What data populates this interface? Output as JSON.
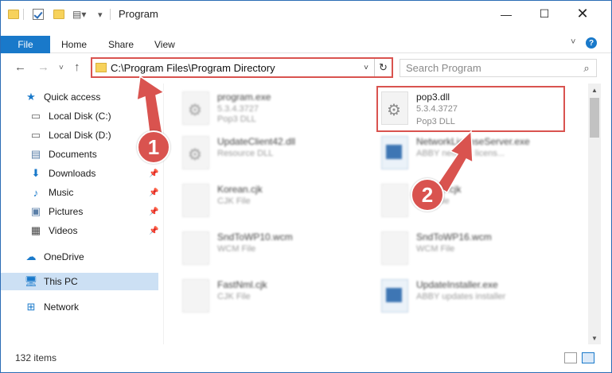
{
  "window": {
    "title": "Program"
  },
  "ribbon": {
    "file": "File",
    "home": "Home",
    "share": "Share",
    "view": "View"
  },
  "address": {
    "path": "C:\\Program Files\\Program Directory"
  },
  "search": {
    "placeholder": "Search Program"
  },
  "sidebar": {
    "items": [
      {
        "label": "Quick access",
        "icon": "star-icon"
      },
      {
        "label": "Local Disk (C:)",
        "icon": "drive-icon"
      },
      {
        "label": "Local Disk (D:)",
        "icon": "drive-icon"
      },
      {
        "label": "Documents",
        "icon": "documents-icon"
      },
      {
        "label": "Downloads",
        "icon": "download-icon"
      },
      {
        "label": "Music",
        "icon": "music-icon"
      },
      {
        "label": "Pictures",
        "icon": "pictures-icon"
      },
      {
        "label": "Videos",
        "icon": "videos-icon"
      },
      {
        "label": "OneDrive",
        "icon": "cloud-icon"
      },
      {
        "label": "This PC",
        "icon": "computer-icon"
      },
      {
        "label": "Network",
        "icon": "network-icon"
      }
    ]
  },
  "files": [
    {
      "name": "program.exe",
      "version": "5.3.4.3727",
      "type": "Pop3 DLL"
    },
    {
      "name": "pop3.dll",
      "version": "5.3.4.3727",
      "type": "Pop3 DLL"
    },
    {
      "name": "UpdateClient42.dll",
      "type": "Resource DLL"
    },
    {
      "name": "NetworkLicenseServer.exe",
      "type": "ABBY network licens..."
    },
    {
      "name": "Korean.cjk",
      "type": "CJK File"
    },
    {
      "name": "ABBYY.cjk",
      "type": "CJK File"
    },
    {
      "name": "SndToWP10.wcm",
      "type": "WCM File"
    },
    {
      "name": "SndToWP16.wcm",
      "type": "WCM File"
    },
    {
      "name": "FastNml.cjk",
      "type": "CJK File"
    },
    {
      "name": "UpdateInstaller.exe",
      "type": "ABBY updates installer"
    }
  ],
  "status": {
    "count": "132 items"
  },
  "annotations": {
    "step1": "1",
    "step2": "2"
  },
  "colors": {
    "accent": "#1979ca",
    "highlight": "#d9534f",
    "selected": "#cce0f4"
  }
}
